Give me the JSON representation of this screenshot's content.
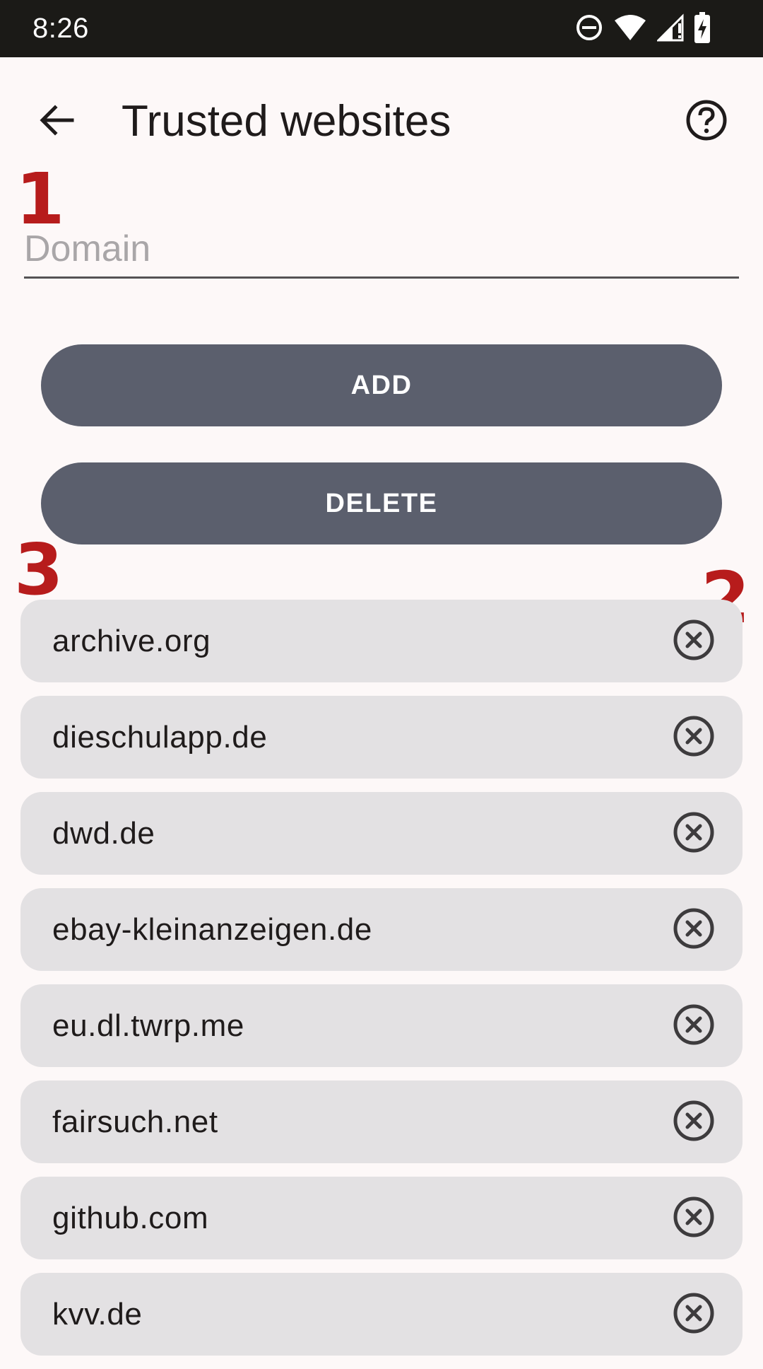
{
  "status_bar": {
    "time": "8:26",
    "icons": [
      "do-not-disturb-icon",
      "wifi-icon",
      "cellular-signal-icon",
      "battery-charging-icon"
    ]
  },
  "header": {
    "title": "Trusted websites",
    "back_icon": "arrow-left-icon",
    "help_icon": "help-circle-icon"
  },
  "annotations": {
    "input_marker": "1",
    "remove_marker": "2",
    "list_marker": "3"
  },
  "domain_field": {
    "placeholder": "Domain",
    "value": ""
  },
  "actions": {
    "add_label": "ADD",
    "delete_label": "DELETE"
  },
  "sites": [
    "archive.org",
    "dieschulapp.de",
    "dwd.de",
    "ebay-kleinanzeigen.de",
    "eu.dl.twrp.me",
    "fairsuch.net",
    "github.com",
    "kvv.de"
  ],
  "colors": {
    "accent_annotation": "#b71c1c",
    "button_background": "#5b5f6d",
    "item_background": "#e3e1e3",
    "status_bar_background": "#1b1a17"
  }
}
